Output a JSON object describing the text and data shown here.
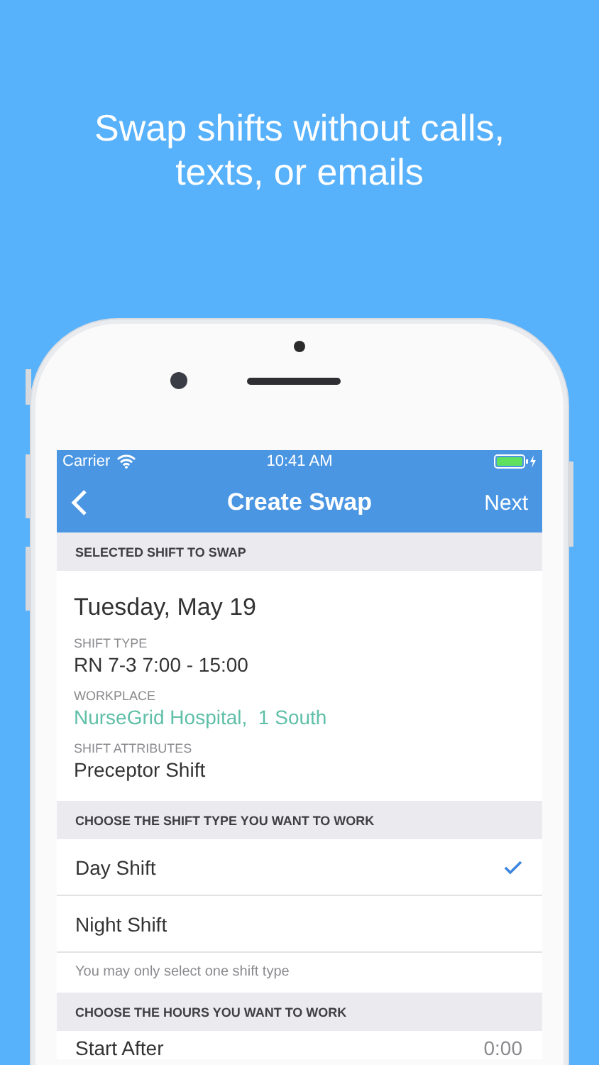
{
  "headline": "Swap shifts without calls, texts, or emails",
  "status_bar": {
    "carrier": "Carrier",
    "time": "10:41 AM"
  },
  "nav": {
    "title": "Create Swap",
    "next": "Next"
  },
  "selected_shift": {
    "header": "SELECTED SHIFT TO SWAP",
    "date": "Tuesday, May 19",
    "fields": [
      {
        "label": "SHIFT TYPE",
        "value": "RN 7-3 7:00 - 15:00",
        "kind": "plain"
      },
      {
        "label": "WORKPLACE",
        "value": "NurseGrid Hospital,  1 South",
        "kind": "link"
      },
      {
        "label": "SHIFT ATTRIBUTES",
        "value": "Preceptor Shift",
        "kind": "plain"
      }
    ]
  },
  "shift_type": {
    "header": "CHOOSE THE SHIFT TYPE YOU WANT TO WORK",
    "options": [
      {
        "label": "Day Shift",
        "selected": true
      },
      {
        "label": "Night Shift",
        "selected": false
      }
    ],
    "hint": "You may only select one shift type"
  },
  "hours": {
    "header": "CHOOSE THE HOURS YOU WANT TO WORK",
    "rows": [
      {
        "label": "Start After",
        "value": "0:00"
      }
    ]
  }
}
